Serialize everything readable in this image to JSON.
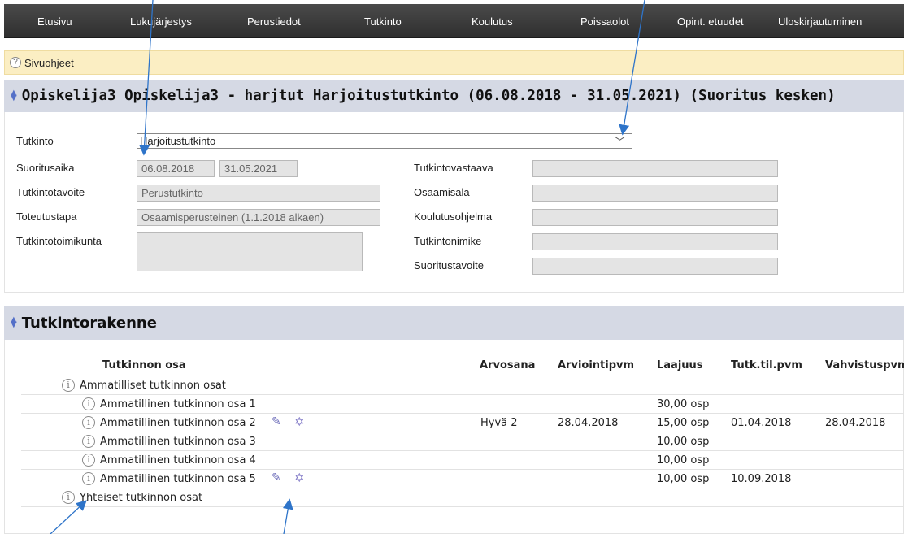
{
  "nav": {
    "items": [
      "Etusivu",
      "Lukujärjestys",
      "Perustiedot",
      "Tutkinto",
      "Koulutus",
      "Poissaolot",
      "Opint. etuudet",
      "Uloskirjautuminen"
    ]
  },
  "help": {
    "label": "Sivuohjeet"
  },
  "student_section": {
    "title": "Opiskelija3 Opiskelija3 - harjtut Harjoitustutkinto (06.08.2018 - 31.05.2021)  (Suoritus kesken)"
  },
  "form": {
    "tutkinto_label": "Tutkinto",
    "tutkinto_value": "Harjoitustutkinto",
    "suoritusaika_label": "Suoritusaika",
    "suoritusaika_start": "06.08.2018",
    "suoritusaika_end": "31.05.2021",
    "tutkintotavoite_label": "Tutkintotavoite",
    "tutkintotavoite_value": "Perustutkinto",
    "toteutustapa_label": "Toteutustapa",
    "toteutustapa_value": "Osaamisperusteinen (1.1.2018 alkaen)",
    "tutkintotoimikunta_label": "Tutkintotoimikunta",
    "tutkintotoimikunta_value": "",
    "tutkintovastaava_label": "Tutkintovastaava",
    "tutkintovastaava_value": "",
    "osaamisala_label": "Osaamisala",
    "osaamisala_value": "",
    "koulutusohjelma_label": "Koulutusohjelma",
    "koulutusohjelma_value": "",
    "tutkintonimike_label": "Tutkintonimike",
    "tutkintonimike_value": "",
    "suoritustavoite_label": "Suoritustavoite",
    "suoritustavoite_value": ""
  },
  "structure_section": {
    "title": "Tutkintorakenne"
  },
  "table": {
    "headers": [
      "Tutkinnon osa",
      "Arvosana",
      "Arviointipvm",
      "Laajuus",
      "Tutk.til.pvm",
      "Vahvistuspvm"
    ],
    "rows": [
      {
        "name": "Ammatilliset tutkinnon osat",
        "grade": "",
        "date": "",
        "scope": "",
        "reg": "",
        "confirm": ""
      },
      {
        "name": "Ammatillinen tutkinnon osa 1",
        "grade": "",
        "date": "",
        "scope": "30,00 osp",
        "reg": "",
        "confirm": ""
      },
      {
        "name": "Ammatillinen tutkinnon osa 2",
        "grade": "Hyvä 2",
        "date": "28.04.2018",
        "scope": "15,00 osp",
        "reg": "01.04.2018",
        "confirm": "28.04.2018"
      },
      {
        "name": "Ammatillinen tutkinnon osa 3",
        "grade": "",
        "date": "",
        "scope": "10,00 osp",
        "reg": "",
        "confirm": ""
      },
      {
        "name": "Ammatillinen tutkinnon osa 4",
        "grade": "",
        "date": "",
        "scope": "10,00 osp",
        "reg": "",
        "confirm": ""
      },
      {
        "name": "Ammatillinen tutkinnon osa 5",
        "grade": "",
        "date": "",
        "scope": "10,00 osp",
        "reg": "10.09.2018",
        "confirm": ""
      },
      {
        "name": "Yhteiset tutkinnon osat",
        "grade": "",
        "date": "",
        "scope": "",
        "reg": "",
        "confirm": ""
      }
    ]
  },
  "icons": {
    "info": "info-icon",
    "edit": "pencil-icon",
    "badge": "star-icon",
    "help": "help-icon"
  },
  "colors": {
    "nav_bg": "#3a3a3a",
    "help_bg": "#fbeec3",
    "section_bg": "#d5d9e4",
    "field_bg": "#e4e4e4",
    "callout": "#2e74c9"
  }
}
